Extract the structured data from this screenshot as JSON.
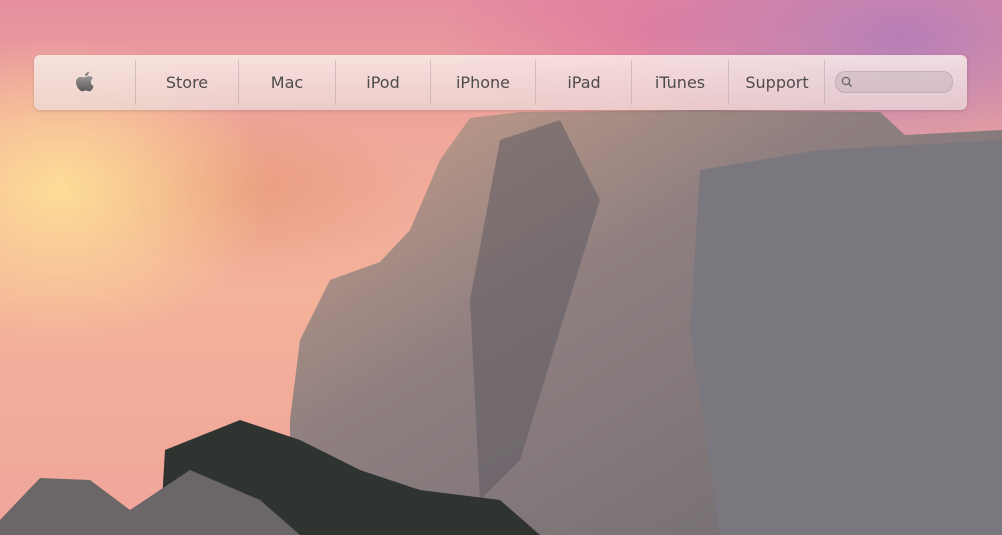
{
  "nav": {
    "logo_icon": "apple-logo-icon",
    "items": [
      {
        "label": "Store"
      },
      {
        "label": "Mac"
      },
      {
        "label": "iPod"
      },
      {
        "label": "iPhone"
      },
      {
        "label": "iPad"
      },
      {
        "label": "iTunes"
      },
      {
        "label": "Support"
      }
    ],
    "search": {
      "icon": "search-icon",
      "value": "",
      "placeholder": ""
    }
  }
}
